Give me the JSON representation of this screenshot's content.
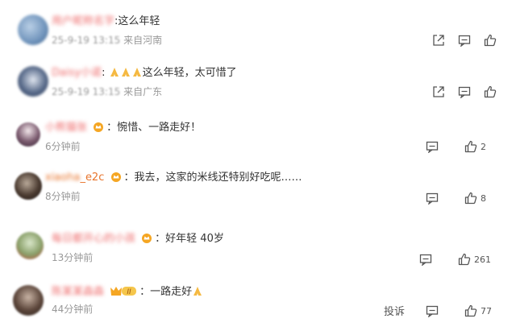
{
  "comments": [
    {
      "username": "用户昵称名字",
      "sep": ":",
      "text": "这么年轻",
      "date": "25-9-19 13:15",
      "location": "来自河南",
      "likes": ""
    },
    {
      "username": "Daisy小诺",
      "sep": ":",
      "text": "这么年轻，太可惜了",
      "date": "25-9-19 13:15",
      "location": "来自广东",
      "likes": ""
    },
    {
      "username": "小熊猫张",
      "sep": "：",
      "text": "惋惜、一路走好！",
      "time": "6分钟前",
      "likes": "2"
    },
    {
      "username": "xiaoha_e2c",
      "sep": "：",
      "text": "我去，这家的米线还特别好吃呢……",
      "time": "8分钟前",
      "likes": "8"
    },
    {
      "username": "每日都开心的小孩",
      "sep": "：",
      "text": "好年轻 40岁",
      "time": "13分钟前",
      "likes": "261"
    },
    {
      "username": "陈某某森森",
      "sep": "：",
      "text": "一路走好",
      "time": "44分钟前",
      "likes": "77",
      "vip_level": "II",
      "report": "投诉"
    }
  ],
  "colors": {
    "username": "#e8742c",
    "meta": "#999999",
    "icon": "#555555",
    "crown": "#f5a623"
  },
  "icons": [
    "share-icon",
    "comment-icon",
    "like-icon",
    "crown-badge-icon",
    "pray-emoji-icon"
  ]
}
